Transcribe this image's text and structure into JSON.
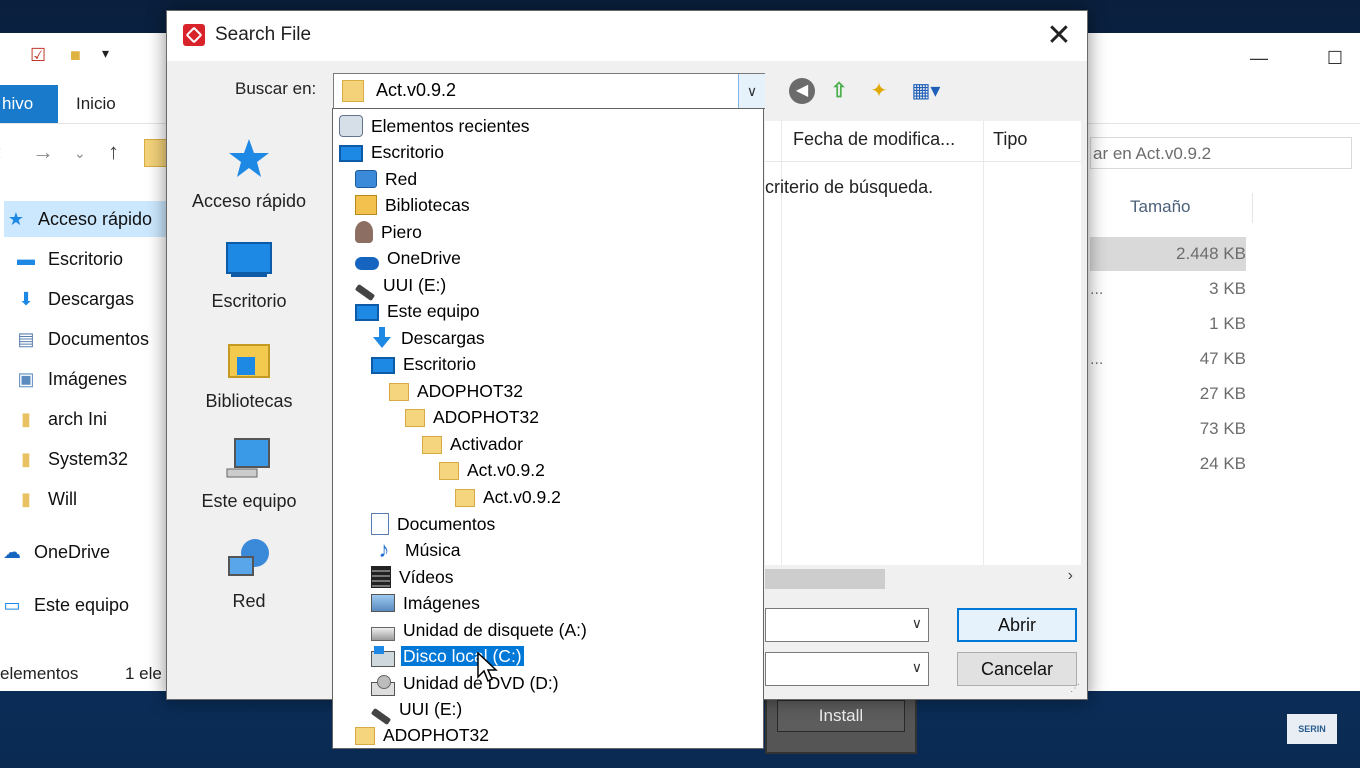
{
  "explorer": {
    "ribbon_tabs": {
      "file": "hivo",
      "home": "Inicio"
    },
    "search_placeholder": "ar en Act.v0.9.2",
    "nav_items": [
      {
        "label": "Acceso rápido",
        "icon": "star-icon"
      },
      {
        "label": "Escritorio",
        "icon": "desktop-icon"
      },
      {
        "label": "Descargas",
        "icon": "downloads-icon"
      },
      {
        "label": "Documentos",
        "icon": "documents-icon"
      },
      {
        "label": "Imágenes",
        "icon": "pictures-icon"
      },
      {
        "label": "arch Ini",
        "icon": "folder-icon"
      },
      {
        "label": "System32",
        "icon": "folder-icon"
      },
      {
        "label": "Will",
        "icon": "folder-icon"
      },
      {
        "label": "OneDrive",
        "icon": "onedrive-icon"
      },
      {
        "label": "Este equipo",
        "icon": "this-pc-icon"
      }
    ],
    "size_column": "Tamaño",
    "sizes": [
      "2.448 KB",
      "3 KB",
      "1 KB",
      "47 KB",
      "27 KB",
      "73 KB",
      "24 KB"
    ],
    "status_left": "elementos",
    "status_right": "1 ele"
  },
  "dialog": {
    "title": "Search File",
    "look_in_label": "Buscar en:",
    "look_in_value": "Act.v0.9.2",
    "places": [
      {
        "label": "Acceso rápido",
        "icon": "star-icon"
      },
      {
        "label": "Escritorio",
        "icon": "desktop-icon"
      },
      {
        "label": "Bibliotecas",
        "icon": "libraries-icon"
      },
      {
        "label": "Este equipo",
        "icon": "this-pc-icon"
      },
      {
        "label": "Red",
        "icon": "network-icon"
      }
    ],
    "columns": {
      "modified": "Fecha de modifica...",
      "type": "Tipo"
    },
    "empty_message": "criterio de búsqueda.",
    "open_button": "Abrir",
    "cancel_button": "Cancelar"
  },
  "dropdown_items": [
    {
      "label": "Elementos recientes",
      "icon": "recent-icon"
    },
    {
      "label": "Escritorio",
      "icon": "desktop-icon"
    },
    {
      "label": "Red",
      "icon": "network-icon"
    },
    {
      "label": "Bibliotecas",
      "icon": "libraries-icon"
    },
    {
      "label": "Piero",
      "icon": "user-icon"
    },
    {
      "label": "OneDrive",
      "icon": "onedrive-icon"
    },
    {
      "label": "UUI (E:)",
      "icon": "usb-drive-icon"
    },
    {
      "label": "Este equipo",
      "icon": "this-pc-icon"
    },
    {
      "label": "Descargas",
      "icon": "downloads-icon"
    },
    {
      "label": "Escritorio",
      "icon": "desktop-icon"
    },
    {
      "label": "ADOPHOT32",
      "icon": "folder-icon"
    },
    {
      "label": "ADOPHOT32",
      "icon": "folder-icon"
    },
    {
      "label": "Activador",
      "icon": "folder-icon"
    },
    {
      "label": "Act.v0.9.2",
      "icon": "folder-icon"
    },
    {
      "label": "Act.v0.9.2",
      "icon": "folder-icon"
    },
    {
      "label": "Documentos",
      "icon": "documents-icon"
    },
    {
      "label": "Música",
      "icon": "music-icon"
    },
    {
      "label": "Vídeos",
      "icon": "videos-icon"
    },
    {
      "label": "Imágenes",
      "icon": "pictures-icon"
    },
    {
      "label": "Unidad de disquete (A:)",
      "icon": "floppy-drive-icon"
    },
    {
      "label": "Disco local (C:)",
      "icon": "local-disk-icon",
      "selected": true
    },
    {
      "label": "Unidad de DVD (D:)",
      "icon": "dvd-drive-icon"
    },
    {
      "label": "UUI (E:)",
      "icon": "usb-drive-icon"
    },
    {
      "label": "ADOPHOT32",
      "icon": "folder-icon"
    }
  ],
  "install_button": "Install",
  "watermark": "SERIN"
}
